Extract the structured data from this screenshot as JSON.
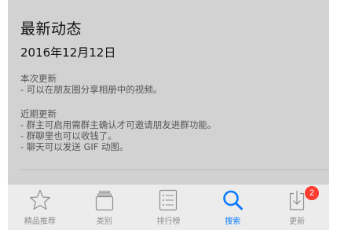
{
  "update": {
    "title": "最新动态",
    "date": "2016年12月12日",
    "sections": [
      {
        "heading": "本次更新",
        "lines": [
          "- 可以在朋友圈分享相册中的视频。"
        ]
      },
      {
        "heading": "近期更新",
        "lines": [
          "- 群主可启用需群主确认才可邀请朋友进群功能。",
          "- 群聊里也可以收钱了。",
          "- 聊天可以发送 GIF 动图。"
        ]
      }
    ]
  },
  "tabbar": {
    "active": "search",
    "accent_color": "#0a7aff",
    "badge_color": "#ff3b30",
    "tabs": [
      {
        "id": "featured",
        "label": "精品推荐",
        "icon": "star-icon"
      },
      {
        "id": "categories",
        "label": "类别",
        "icon": "categories-icon"
      },
      {
        "id": "top-charts",
        "label": "排行榜",
        "icon": "list-icon"
      },
      {
        "id": "search",
        "label": "搜索",
        "icon": "search-icon"
      },
      {
        "id": "updates",
        "label": "更新",
        "icon": "download-icon",
        "badge": "2"
      }
    ]
  }
}
